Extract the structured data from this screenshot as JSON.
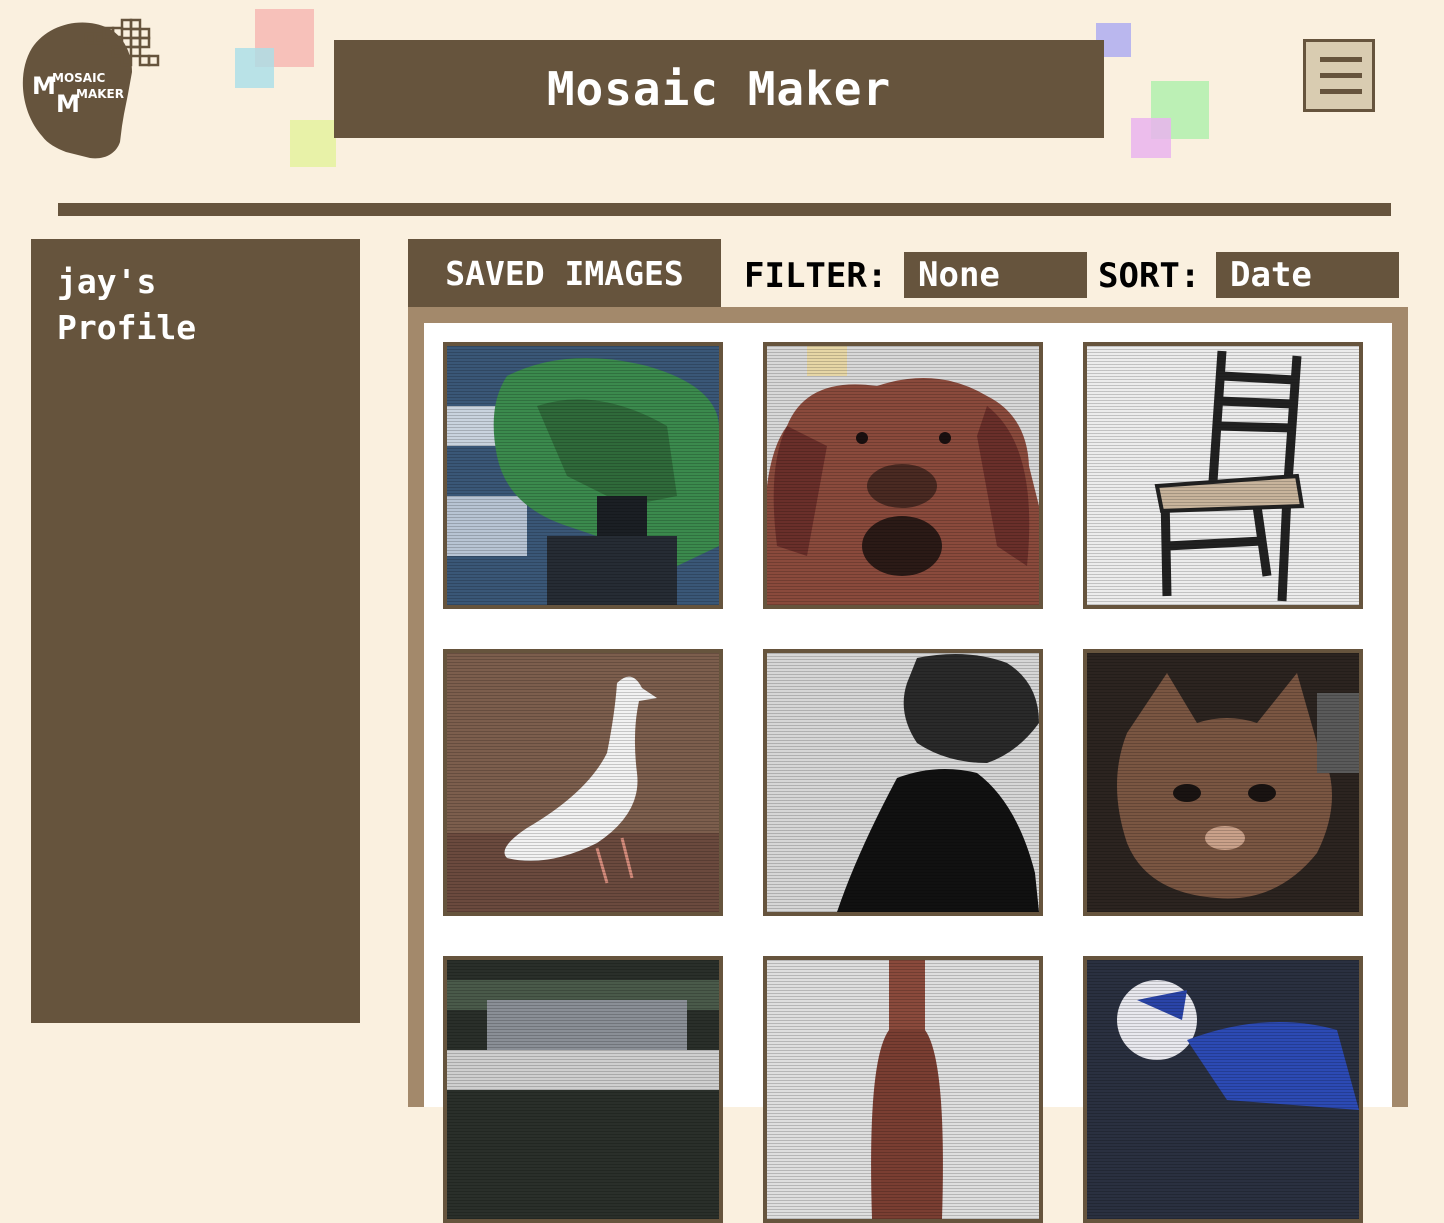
{
  "app": {
    "title": "Mosaic Maker",
    "logo_text_line1": "MOSAIC",
    "logo_text_line2": "MAKER"
  },
  "colors": {
    "background": "#faf0df",
    "primary": "#66543d",
    "frame": "#a3896b",
    "menu_button": "#d9ccb1"
  },
  "header": {
    "menu_icon": "hamburger-menu-icon",
    "decor_squares": [
      "#f6b5b0",
      "#a9dfe8",
      "#e6f2a2",
      "#b3b0ef",
      "#b5efb0",
      "#e9b4ef"
    ]
  },
  "sidebar": {
    "profile_title": "jay's\nProfile"
  },
  "gallery": {
    "tab_label": "SAVED IMAGES",
    "filter_label": "FILTER:",
    "filter_value": "None",
    "sort_label": "SORT:",
    "sort_value": "Date",
    "images": [
      {
        "subject": "tree"
      },
      {
        "subject": "dog"
      },
      {
        "subject": "chair"
      },
      {
        "subject": "duck"
      },
      {
        "subject": "dark-shape"
      },
      {
        "subject": "cat"
      },
      {
        "subject": "crowd"
      },
      {
        "subject": "bottle"
      },
      {
        "subject": "football-player"
      }
    ]
  }
}
